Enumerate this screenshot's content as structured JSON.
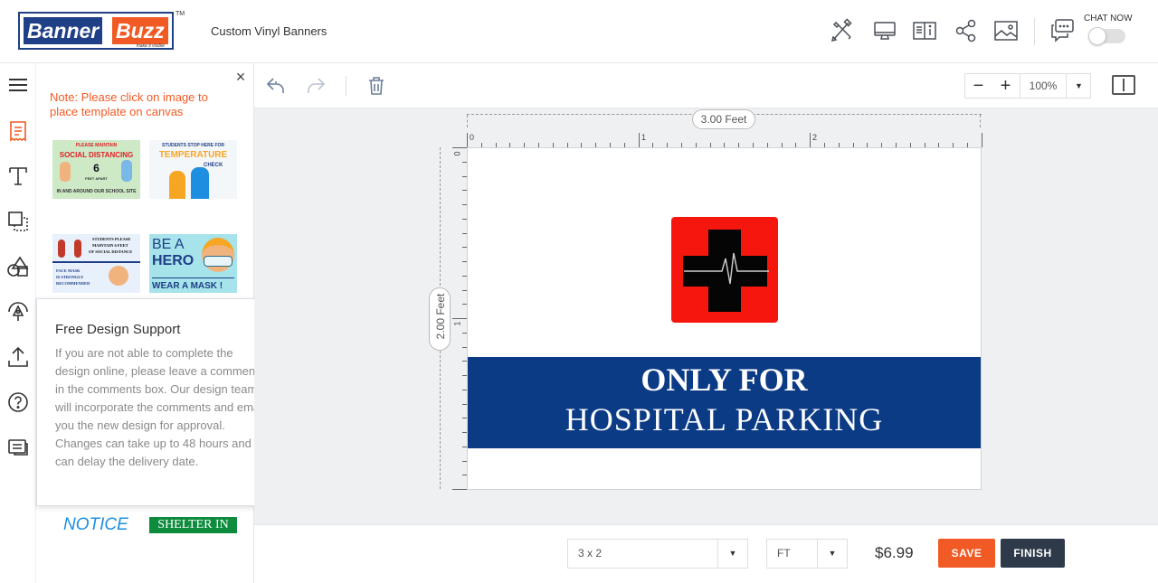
{
  "header": {
    "logo_banner": "Banner",
    "logo_buzz": "Buzz",
    "logo_tagline": "make it visible",
    "logo_tm": "TM",
    "product_name": "Custom Vinyl Banners",
    "chat_label": "CHAT NOW",
    "icons": [
      "design-tools-icon",
      "preview-desktop-icon",
      "product-info-icon",
      "share-icon",
      "image-icon",
      "chat-icon"
    ]
  },
  "rail": {
    "items": [
      "menu-icon",
      "templates-icon",
      "text-icon",
      "layers-icon",
      "shapes-icon",
      "clipart-icon",
      "upload-icon",
      "help-icon",
      "comments-icon"
    ]
  },
  "panel": {
    "close": "×",
    "note": "Note: Please click on image to place template on canvas",
    "templates": [
      {
        "lines": [
          "PLEASE MAINTAIN",
          "SOCIAL DISTANCING",
          "6",
          "FEET APART",
          "IN AND AROUND OUR SCHOOL SITE"
        ]
      },
      {
        "lines": [
          "STUDENTS STOP HERE FOR",
          "TEMPERATURE",
          "CHECK"
        ]
      },
      {
        "lines": [
          "STUDENTS PLEASE",
          "MAINTAIN 6 FEET",
          "OF SOCIAL DISTANCE",
          "FACE MASK",
          "IS STRONGLY",
          "RECOMMENDED"
        ]
      },
      {
        "lines": [
          "BE A",
          "HERO",
          "WEAR A MASK !"
        ]
      }
    ],
    "more_templates": [
      "NOTICE",
      "SHELTER IN"
    ]
  },
  "popup": {
    "title": "Free Design Support",
    "close": "×",
    "body": "If you are not able to complete the design online, please leave a comments in the comments box. Our design team will incorporate the comments and email you the new design for approval. Changes can take up to 48 hours and can delay the delivery date."
  },
  "toolbar": {
    "zoom_minus": "−",
    "zoom_plus": "+",
    "zoom_value": "100%",
    "zoom_dropdown": "▼"
  },
  "canvas": {
    "width_label": "3.00 Feet",
    "height_label": "2.00 Feet",
    "ruler_h": [
      "0",
      "1",
      "2"
    ],
    "ruler_v": [
      "0",
      "1"
    ],
    "banner_line1": "ONLY FOR",
    "banner_line2": "HOSPITAL PARKING",
    "colors": {
      "cross_box": "#f5160e",
      "strip": "#0c3b86"
    }
  },
  "footer": {
    "size_value": "3 x 2",
    "unit_value": "FT",
    "dropdown_arrow": "▼",
    "price": "$6.99",
    "save_label": "SAVE",
    "finish_label": "FINISH"
  },
  "colors": {
    "accent": "#f15a24",
    "brand_blue": "#1f3f86",
    "dark_button": "#2e3a4a"
  }
}
